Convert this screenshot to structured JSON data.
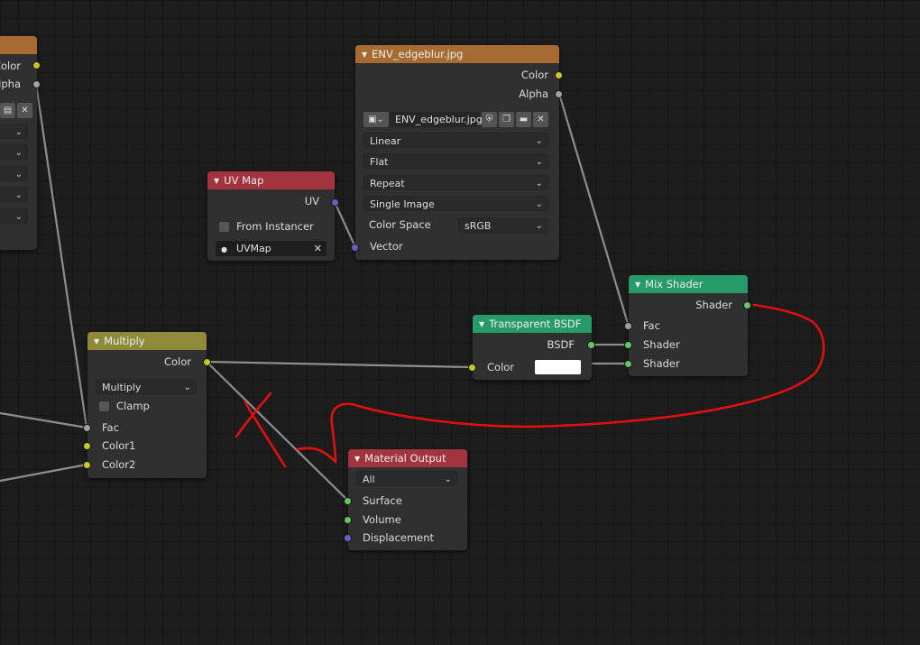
{
  "colors": {
    "header_texture": "#a66a32",
    "header_input": "#a1343d",
    "header_converter": "#8f8a3a",
    "header_shader": "#279a6a",
    "header_output": "#a1343d",
    "socket_color": "#c7c729",
    "socket_float": "#a1a1a1",
    "socket_vector": "#6363c7",
    "socket_shader": "#63c763",
    "annotation_red": "#e01010"
  },
  "left_node": {
    "outputs": [
      "Color",
      "Alpha"
    ]
  },
  "env_texture": {
    "title": "ENV_edgeblur.jpg",
    "outputs": {
      "color": "Color",
      "alpha": "Alpha"
    },
    "image_name": "ENV_edgeblur.jpg",
    "interpolation": "Linear",
    "projection": "Flat",
    "extension": "Repeat",
    "source": "Single Image",
    "color_space_label": "Color Space",
    "color_space_value": "sRGB",
    "input_vector": "Vector"
  },
  "uv_map": {
    "title": "UV Map",
    "output_uv": "UV",
    "from_instancer": "From Instancer",
    "uvmap_value": "UVMap"
  },
  "multiply": {
    "title": "Multiply",
    "output_color": "Color",
    "blend_mode": "Multiply",
    "clamp": "Clamp",
    "inputs": {
      "fac": "Fac",
      "color1": "Color1",
      "color2": "Color2"
    }
  },
  "transparent_bsdf": {
    "title": "Transparent BSDF",
    "output_bsdf": "BSDF",
    "input_color": "Color",
    "color_value": "#ffffff"
  },
  "mix_shader": {
    "title": "Mix Shader",
    "output_shader": "Shader",
    "inputs": {
      "fac": "Fac",
      "shader1": "Shader",
      "shader2": "Shader"
    }
  },
  "material_output": {
    "title": "Material Output",
    "target": "All",
    "inputs": {
      "surface": "Surface",
      "volume": "Volume",
      "displacement": "Displacement"
    }
  }
}
